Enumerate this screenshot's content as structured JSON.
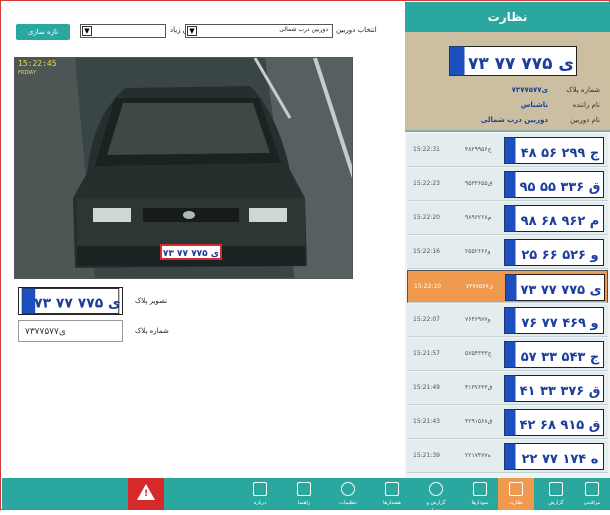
{
  "header": {
    "title": "نظارت"
  },
  "toolbar": {
    "refresh_label": "تازه سازی",
    "speed_label": "سرعت پخش زیاد",
    "camera_label": "انتخاب دوربین",
    "camera_value": "دوربین درب شمالی"
  },
  "camera": {
    "timestamp": "15:22:45",
    "subline": "FRIDAY"
  },
  "plate": {
    "image_label": "تصویر پلاک",
    "number_label": "شماره پلاک",
    "number_value": "۷۳ی۷۷۵۷۷",
    "display": "۷۳ ی ۷۷۵ ۷۷"
  },
  "detail": {
    "plate_display": "۷۳ ی ۷۷۵ ۷۷",
    "rows": [
      {
        "k": "شماره پلاک",
        "v": "۷۳ی۷۷۵۷۷"
      },
      {
        "k": "نام راننده",
        "v": "ناشناس"
      },
      {
        "k": "نام دوربین",
        "v": "دوربین درب شمالی"
      }
    ]
  },
  "records": [
    {
      "time": "15:22:31",
      "code": "۴۸ج۲۹۹۵۶",
      "plate": "۴۸ ج ۲۹۹ ۵۶",
      "selected": false
    },
    {
      "time": "15:22:23",
      "code": "۹۵ق۳۳۶۵۵",
      "plate": "۹۵ ق ۳۳۶ ۵۵",
      "selected": false
    },
    {
      "time": "15:22:20",
      "code": "۹۸م۹۶۲۶۸",
      "plate": "۹۸ م ۹۶۲ ۶۸",
      "selected": false
    },
    {
      "time": "15:22:16",
      "code": "۲۵و۵۲۶۶۶",
      "plate": "۲۵ و ۵۲۶ ۶۶",
      "selected": false
    },
    {
      "time": "15:22:10",
      "code": "۷۳ی۷۷۵۷۷",
      "plate": "۷۳ ی ۷۷۵ ۷۷",
      "selected": true
    },
    {
      "time": "15:22:07",
      "code": "۷۶و۴۶۹۷۷",
      "plate": "۷۶ و ۴۶۹ ۷۷",
      "selected": false
    },
    {
      "time": "15:21:57",
      "code": "۵۷ج۵۴۳۳۳",
      "plate": "۵۷ ج ۵۴۳ ۳۳",
      "selected": false
    },
    {
      "time": "15:21:49",
      "code": "۴۱ق۳۷۶۳۳",
      "plate": "۴۱ ق ۳۷۶ ۳۳",
      "selected": false
    },
    {
      "time": "15:21:43",
      "code": "۴۲ق۹۱۵۶۸",
      "plate": "۴۲ ق ۹۱۵ ۶۸",
      "selected": false
    },
    {
      "time": "15:21:39",
      "code": "۲۲ه۱۷۴۷۷",
      "plate": "۲۲ ه ۱۷۴ ۷۷",
      "selected": false
    }
  ],
  "nav": [
    {
      "label": "درباره",
      "icon": "about-icon"
    },
    {
      "label": "راهنما",
      "icon": "help-icon"
    },
    {
      "label": "تنظیمات",
      "icon": "settings-icon"
    },
    {
      "label": "هشدارها",
      "icon": "alarms-icon"
    },
    {
      "label": "گزارش و پشتیبان",
      "icon": "backup-icon"
    },
    {
      "label": "نمودارها",
      "icon": "charts-icon"
    },
    {
      "label": "نظارت",
      "icon": "monitor-icon",
      "active": true
    },
    {
      "label": "گزارش",
      "icon": "report-icon"
    },
    {
      "label": "مراقبتی",
      "icon": "edit-icon"
    }
  ],
  "colors": {
    "teal": "#2aa8a0",
    "orange": "#ef9a4f",
    "alert": "#d62a2a",
    "plate_blue": "#1d3e9c"
  }
}
